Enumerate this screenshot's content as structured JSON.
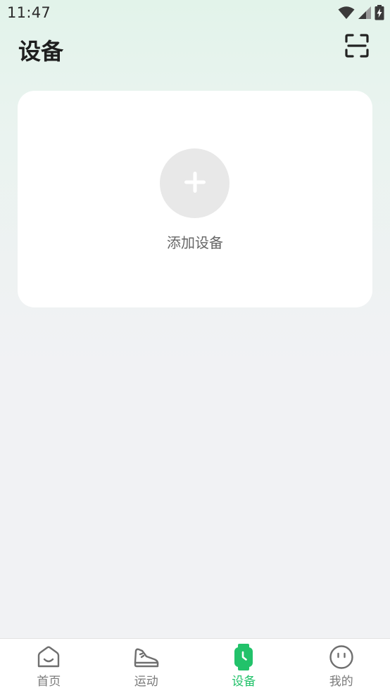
{
  "status_bar": {
    "time": "11:47",
    "icons": [
      "wifi-icon",
      "signal-icon",
      "battery-charging-icon"
    ]
  },
  "header": {
    "title": "设备",
    "scan_icon": "scan-frame-icon"
  },
  "device_card": {
    "add_label": "添加设备",
    "add_icon": "plus-icon"
  },
  "bottom_nav": {
    "items": [
      {
        "label": "首页",
        "icon": "home-icon",
        "active": false
      },
      {
        "label": "运动",
        "icon": "sneaker-icon",
        "active": false
      },
      {
        "label": "设备",
        "icon": "watch-icon",
        "active": true
      },
      {
        "label": "我的",
        "icon": "face-icon",
        "active": false
      }
    ]
  },
  "colors": {
    "accent": "#22c26a",
    "inactive": "#7a7a7a",
    "background": "#f1f2f4",
    "header_tint": "#e2f3ea"
  }
}
